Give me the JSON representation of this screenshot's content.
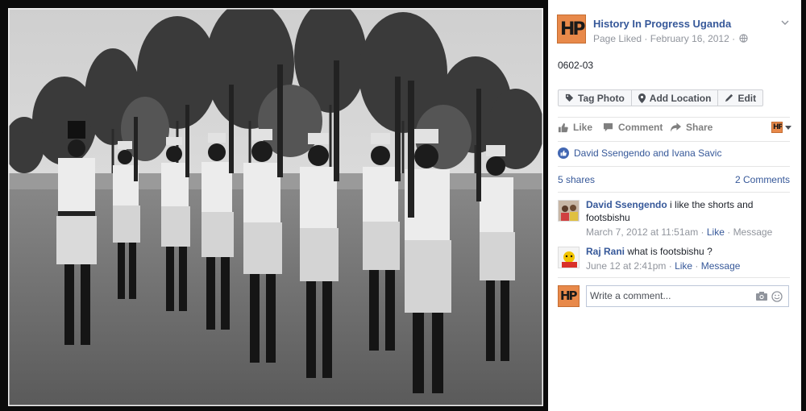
{
  "page": {
    "name": "History In Progress Uganda",
    "meta": "Page Liked · February 16, 2012 ·",
    "logo_text": "HP"
  },
  "post": {
    "caption": "0602-03"
  },
  "photo_actions": [
    {
      "label": "Tag Photo",
      "icon": "tag-icon"
    },
    {
      "label": "Add Location",
      "icon": "location-pin-icon"
    },
    {
      "label": "Edit",
      "icon": "pencil-icon"
    }
  ],
  "actions": {
    "like": "Like",
    "comment": "Comment",
    "share": "Share"
  },
  "likes": {
    "names": "David Ssengendo and Ivana Savic"
  },
  "counts": {
    "shares": "5 shares",
    "comments": "2 Comments"
  },
  "comments": [
    {
      "author": "David Ssengendo",
      "text": " i like the shorts and footsbishu",
      "time": "March 7, 2012 at 11:51am",
      "like": "Like",
      "message": "Message"
    },
    {
      "author": "Raj Rani",
      "text": " what is footsbishu ?",
      "time": "June 12 at 2:41pm",
      "like": "Like",
      "message": "Message"
    }
  ],
  "composer": {
    "placeholder": "Write a comment..."
  },
  "colors": {
    "link": "#365899",
    "brand_orange": "#e8894a",
    "like_blue": "#4267b2"
  }
}
